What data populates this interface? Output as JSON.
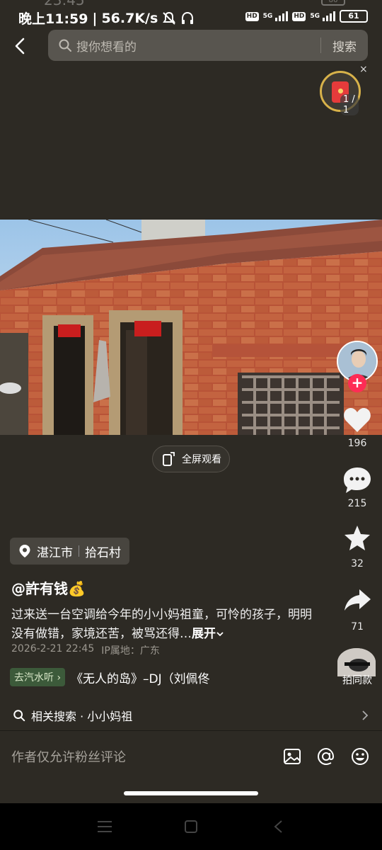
{
  "status_bar": {
    "ghost_time": "23:45",
    "ghost_battery": "86",
    "time_label": "晚上11:59",
    "net_speed": "56.7K/s",
    "hd1": "HD",
    "hd2": "HD",
    "net1": "5G",
    "net2": "5G",
    "battery": "61"
  },
  "search": {
    "placeholder": "搜你想看的",
    "button": "搜索"
  },
  "red_packet": {
    "count": "1 / 1",
    "close": "×"
  },
  "fullscreen_label": "全屏观看",
  "right_rail": {
    "likes": "196",
    "comments": "215",
    "favorites": "32",
    "shares": "71",
    "same_style": "拍同款"
  },
  "location": {
    "city": "湛江市",
    "village": "拾石村"
  },
  "author": "@許有钱💰",
  "description": "过来送一台空调给今年的小小妈祖童，可怜的孩子，明明没有做错，家境还苦，被骂还得…",
  "expand_label": "展开",
  "meta": {
    "date": "2026-2-21 22:45",
    "ip": "IP属地：广东"
  },
  "music": {
    "tag": "去汽水听",
    "title": "《无人的岛》–DJ（刘佩佟"
  },
  "related": {
    "label": "相关搜索 · 小小妈祖"
  },
  "comment": {
    "placeholder": "作者仅允许粉丝评论"
  },
  "colors": {
    "background": "#2d2a24",
    "accent_red": "#fe2c55",
    "gold": "#d8b24a"
  }
}
